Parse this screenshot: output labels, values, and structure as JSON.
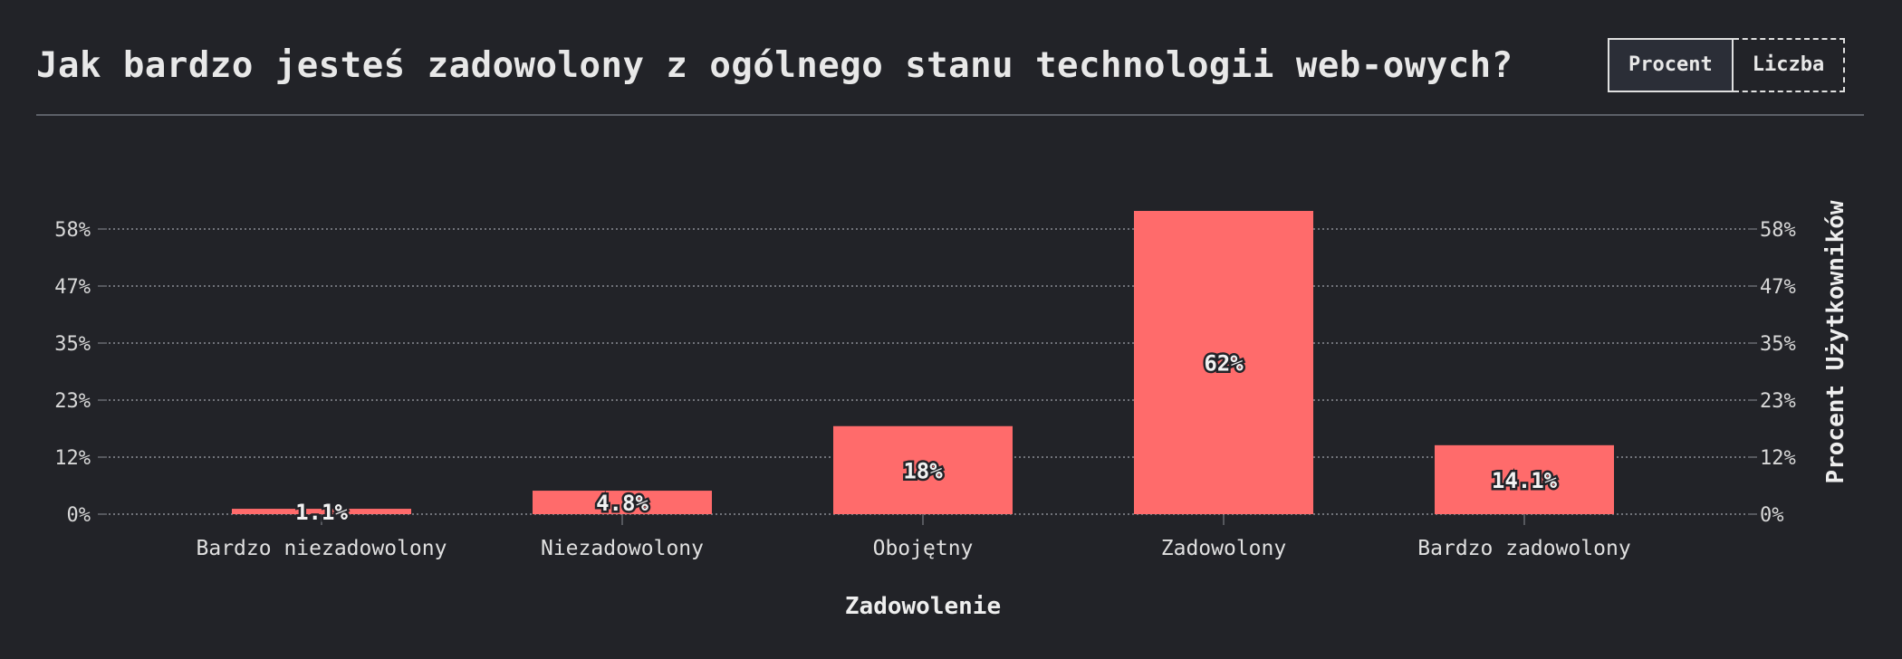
{
  "title": "Jak bardzo jesteś zadowolony z ogólnego stanu technologii web-owych?",
  "toggle": {
    "percent_label": "Procent",
    "count_label": "Liczba",
    "active": "Procent"
  },
  "colors": {
    "bar": "#ff6b6b",
    "background": "#222328"
  },
  "chart_data": {
    "type": "bar",
    "title": "Jak bardzo jesteś zadowolony z ogólnego stanu technologii web-owych?",
    "categories": [
      "Bardzo niezadowolony",
      "Niezadowolony",
      "Obojętny",
      "Zadowolony",
      "Bardzo zadowolony"
    ],
    "values": [
      1.1,
      4.8,
      18,
      62,
      14.1
    ],
    "value_labels": [
      "1.1%",
      "4.8%",
      "18%",
      "62%",
      "14.1%"
    ],
    "xlabel": "Zadowolenie",
    "ylabel": "Procent Użytkowników",
    "yticks": [
      "0%",
      "12%",
      "23%",
      "35%",
      "47%",
      "58%"
    ],
    "ytick_values": [
      0,
      11.66,
      23.32,
      34.98,
      46.64,
      58.3
    ],
    "ylim": [
      0,
      62
    ],
    "grid": true
  }
}
